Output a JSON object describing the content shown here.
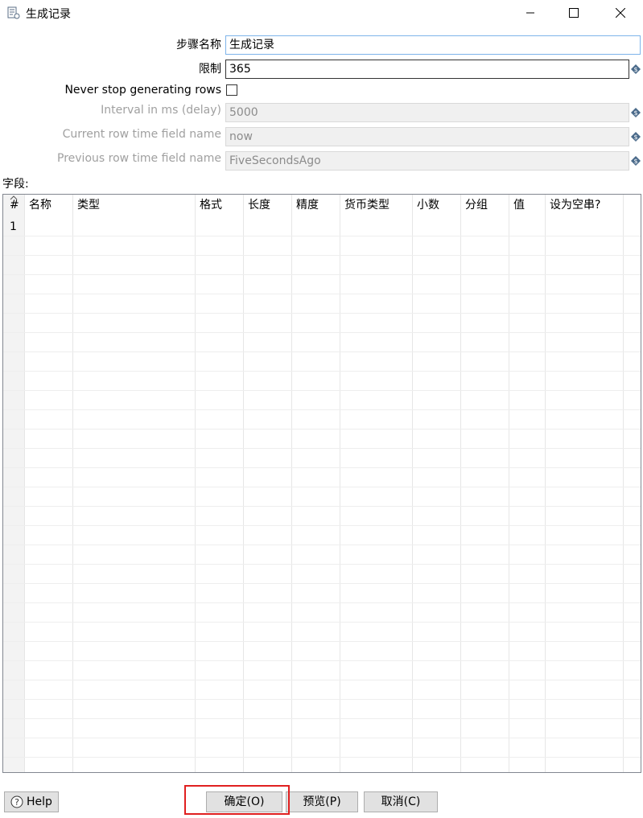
{
  "window": {
    "title": "生成记录",
    "controls": [
      "minimize-icon",
      "maximize-icon",
      "close-icon"
    ]
  },
  "form": {
    "step_name_label": "步骤名称",
    "step_name_value": "生成记录",
    "limit_label": "限制",
    "limit_value": "365",
    "never_stop_label": "Never stop generating rows",
    "never_stop_checked": false,
    "interval_label": "Interval in ms (delay)",
    "interval_value": "5000",
    "current_time_label": "Current row time field name",
    "current_time_value": "now",
    "previous_time_label": "Previous row time field name",
    "previous_time_value": "FiveSecondsAgo"
  },
  "fields": {
    "label": "字段:",
    "columns": [
      "#",
      "名称",
      "类型",
      "格式",
      "长度",
      "精度",
      "货币类型",
      "小数",
      "分组",
      "值",
      "设为空串?"
    ],
    "rows": [
      [
        "1",
        "",
        "",
        "",
        "",
        "",
        "",
        "",
        "",
        "",
        ""
      ]
    ]
  },
  "buttons": {
    "help": "Help",
    "ok": "确定(O)",
    "preview": "预览(P)",
    "cancel": "取消(C)"
  },
  "colors": {
    "highlight": "#e02020",
    "focus_border": "#7eb4ea",
    "variable_icon": "#4a6a8a"
  }
}
